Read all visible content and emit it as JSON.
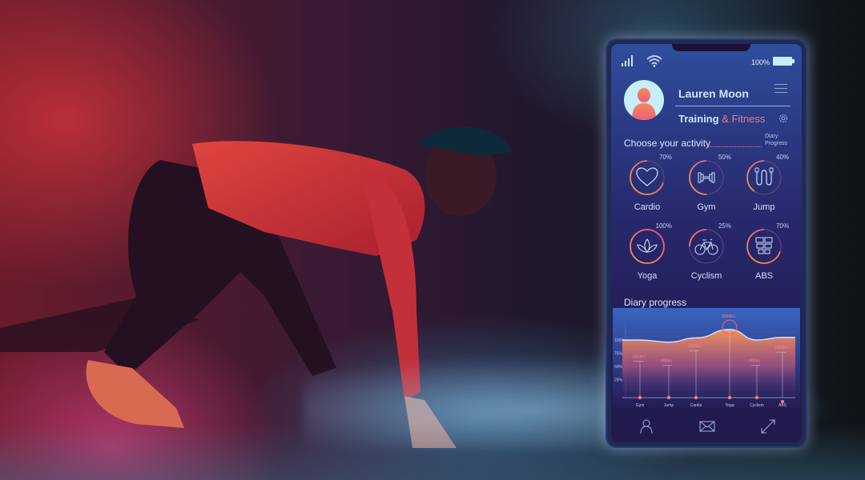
{
  "status_bar": {
    "signal_icon": "signal-bars-icon",
    "wifi_icon": "wifi-icon",
    "battery_percent": "100%",
    "battery_icon": "battery-full-icon"
  },
  "profile": {
    "avatar_icon": "user-avatar-icon",
    "name": "Lauren Moon",
    "subtitle_main": "Training",
    "subtitle_accent": "& Fitness",
    "menu_icon": "hamburger-menu-icon",
    "settings_icon": "gear-icon"
  },
  "activities_section": {
    "title": "Choose your activity",
    "diary_link_line1": "Diary",
    "diary_link_line2": "Progress",
    "items": [
      {
        "label": "Cardio",
        "percent": "70%",
        "progress": 0.7,
        "icon": "heart-icon"
      },
      {
        "label": "Gym",
        "percent": "50%",
        "progress": 0.5,
        "icon": "dumbbell-icon"
      },
      {
        "label": "Jump",
        "percent": "40%",
        "progress": 0.4,
        "icon": "jump-rope-icon"
      },
      {
        "label": "Yoga",
        "percent": "100%",
        "progress": 1.0,
        "icon": "lotus-icon"
      },
      {
        "label": "Cyclism",
        "percent": "25%",
        "progress": 0.25,
        "icon": "bicycle-icon"
      },
      {
        "label": "ABS",
        "percent": "70%",
        "progress": 0.7,
        "icon": "abs-icon"
      }
    ]
  },
  "diary": {
    "title": "Diary progress"
  },
  "chart_data": {
    "type": "area",
    "title": "Diary progress",
    "categories": [
      "Gym",
      "Jump",
      "Cardio",
      "Yoga",
      "Cyclism",
      "ABS"
    ],
    "y_ticks": [
      "100%",
      "75%",
      "50%",
      "25%"
    ],
    "ylim": [
      0,
      100
    ],
    "area_values": [
      100,
      96,
      104,
      120,
      100,
      105
    ],
    "markers": [
      {
        "category": "Gym",
        "label": "1500Kc",
        "value": 60
      },
      {
        "category": "Jump",
        "label": "900Kc",
        "value": 52
      },
      {
        "category": "Cardio",
        "label": "2000Kc",
        "value": 80
      },
      {
        "category": "Yoga",
        "label": "3000Kc",
        "value": 118
      },
      {
        "category": "Cyclism",
        "label": "900Kc",
        "value": 52
      },
      {
        "category": "ABS",
        "label": "1500Kc",
        "value": 77
      }
    ],
    "highlight": "Yoga",
    "grid": true
  },
  "bottom_nav": [
    {
      "name": "profile",
      "icon": "user-outline-icon"
    },
    {
      "name": "messages",
      "icon": "envelope-icon"
    },
    {
      "name": "expand",
      "icon": "expand-arrows-icon"
    }
  ]
}
